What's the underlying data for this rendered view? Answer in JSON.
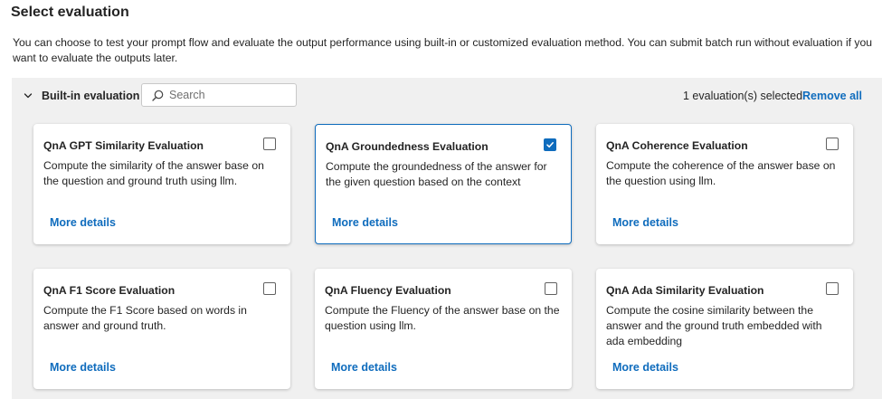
{
  "page": {
    "title": "Select evaluation",
    "description": "You can choose to test your prompt flow and evaluate the output performance using built-in or customized evaluation method. You can submit batch run without evaluation if you want to evaluate the outputs later."
  },
  "builtin": {
    "section_label": "Built-in evaluation",
    "search_placeholder": "Search",
    "selected_count_text": "1 evaluation(s) selected",
    "remove_all_label": "Remove all"
  },
  "cards": [
    {
      "title": "QnA GPT Similarity Evaluation",
      "description": "Compute the similarity of the answer base on the question and ground truth using llm.",
      "link": "More details",
      "checked": false
    },
    {
      "title": "QnA Groundedness Evaluation",
      "description": "Compute the groundedness of the answer for the given question based on the context",
      "link": "More details",
      "checked": true
    },
    {
      "title": "QnA Coherence Evaluation",
      "description": "Compute the coherence of the answer base on the question using llm.",
      "link": "More details",
      "checked": false
    },
    {
      "title": "QnA F1 Score Evaluation",
      "description": "Compute the F1 Score based on words in answer and ground truth.",
      "link": "More details",
      "checked": false
    },
    {
      "title": "QnA Fluency Evaluation",
      "description": "Compute the Fluency of the answer base on the question using llm.",
      "link": "More details",
      "checked": false
    },
    {
      "title": "QnA Ada Similarity Evaluation",
      "description": "Compute the cosine similarity between the answer and the ground truth embedded with ada embedding",
      "link": "More details",
      "checked": false
    }
  ],
  "colors": {
    "accent": "#0f6cbd",
    "panel_background": "#f0f0f0"
  },
  "icons": {
    "toggle": "chevron-down-icon",
    "search": "search-icon",
    "checkmark": "checkmark-icon"
  }
}
